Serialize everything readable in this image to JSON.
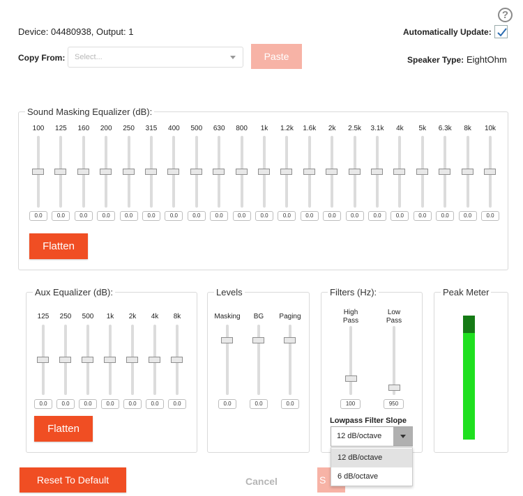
{
  "header": {
    "help_icon": "?",
    "device_info": "Device: 04480938, Output: 1",
    "auto_update_label": "Automatically Update:",
    "auto_update_checked": true,
    "copy_from_label": "Copy From:",
    "copy_from_placeholder": "Select...",
    "paste_label": "Paste",
    "speaker_type_label": "Speaker Type:",
    "speaker_type_value": "EightOhm"
  },
  "sound_masking_eq": {
    "title": "Sound Masking Equalizer (dB):",
    "bands": [
      "100",
      "125",
      "160",
      "200",
      "250",
      "315",
      "400",
      "500",
      "630",
      "800",
      "1k",
      "1.2k",
      "1.6k",
      "2k",
      "2.5k",
      "3.1k",
      "4k",
      "5k",
      "6.3k",
      "8k",
      "10k"
    ],
    "values": [
      "0.0",
      "0.0",
      "0.0",
      "0.0",
      "0.0",
      "0.0",
      "0.0",
      "0.0",
      "0.0",
      "0.0",
      "0.0",
      "0.0",
      "0.0",
      "0.0",
      "0.0",
      "0.0",
      "0.0",
      "0.0",
      "0.0",
      "0.0",
      "0.0"
    ],
    "flatten_label": "Flatten"
  },
  "aux_eq": {
    "title": "Aux Equalizer (dB):",
    "bands": [
      "125",
      "250",
      "500",
      "1k",
      "2k",
      "4k",
      "8k"
    ],
    "values": [
      "0.0",
      "0.0",
      "0.0",
      "0.0",
      "0.0",
      "0.0",
      "0.0"
    ],
    "flatten_label": "Flatten"
  },
  "levels": {
    "title": "Levels",
    "channels": [
      {
        "label": "Masking",
        "value": "0.0"
      },
      {
        "label": "BG",
        "value": "0.0"
      },
      {
        "label": "Paging",
        "value": "0.0"
      }
    ]
  },
  "filters": {
    "title": "Filters (Hz):",
    "high_pass_label": "High Pass",
    "high_pass_value": "100",
    "low_pass_label": "Low Pass",
    "low_pass_value": "950",
    "slope_label": "Lowpass Filter Slope",
    "slope_value": "12 dB/octave",
    "slope_options": [
      "12 dB/octave",
      "6 dB/octave"
    ]
  },
  "peak_meter": {
    "title": "Peak Meter",
    "level_color": "#1fe01f",
    "peak_color": "#157a15"
  },
  "footer": {
    "reset_label": "Reset To Default",
    "cancel_label": "Cancel",
    "save_label": "S"
  },
  "colors": {
    "accent": "#f04e23",
    "accent_disabled": "#f7b3a6"
  }
}
